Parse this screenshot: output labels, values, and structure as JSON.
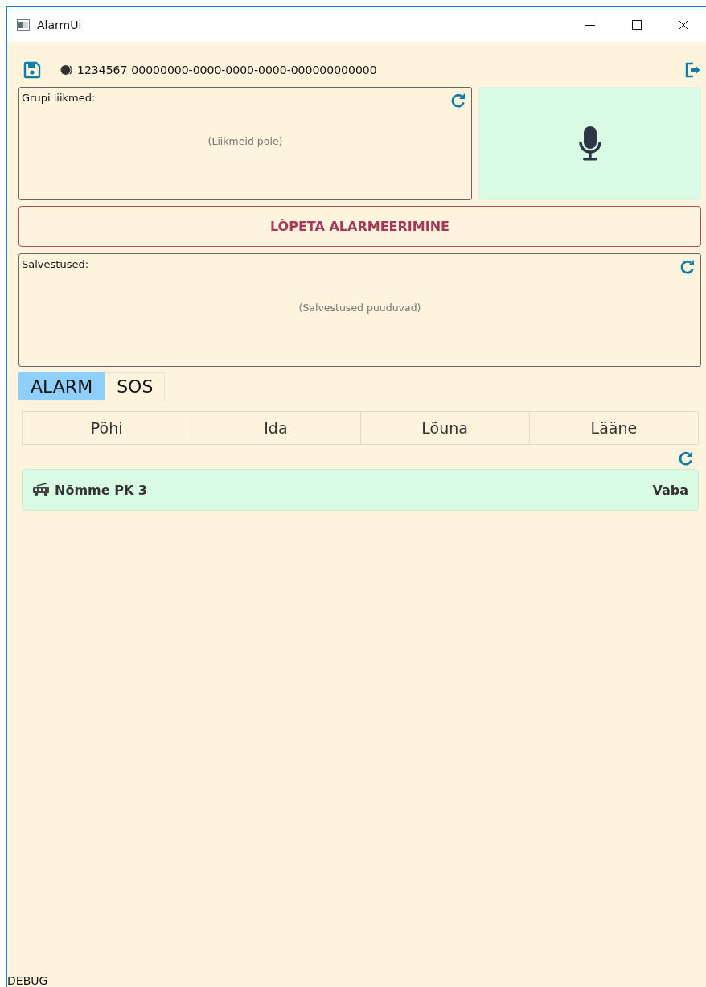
{
  "window": {
    "title": "AlarmUi"
  },
  "header": {
    "phone": "1234567",
    "guid": "00000000-0000-0000-0000-000000000000"
  },
  "members": {
    "label": "Grupi liikmed:",
    "empty": "(Liikmeid pole)"
  },
  "stop_button": "LÕPETA ALARMEERIMINE",
  "recordings": {
    "label": "Salvestused:",
    "empty": "(Salvestused puuduvad)"
  },
  "tabs": [
    {
      "label": "ALARM",
      "selected": true
    },
    {
      "label": "SOS",
      "selected": false
    }
  ],
  "regions": [
    {
      "label": "Põhi",
      "selected": false
    },
    {
      "label": "Ida",
      "selected": false
    },
    {
      "label": "Lõuna",
      "selected": false
    },
    {
      "label": "Lääne",
      "selected": false
    }
  ],
  "units": [
    {
      "name": "Nõmme PK 3",
      "status": "Vaba"
    }
  ],
  "footer": "DEBUG"
}
